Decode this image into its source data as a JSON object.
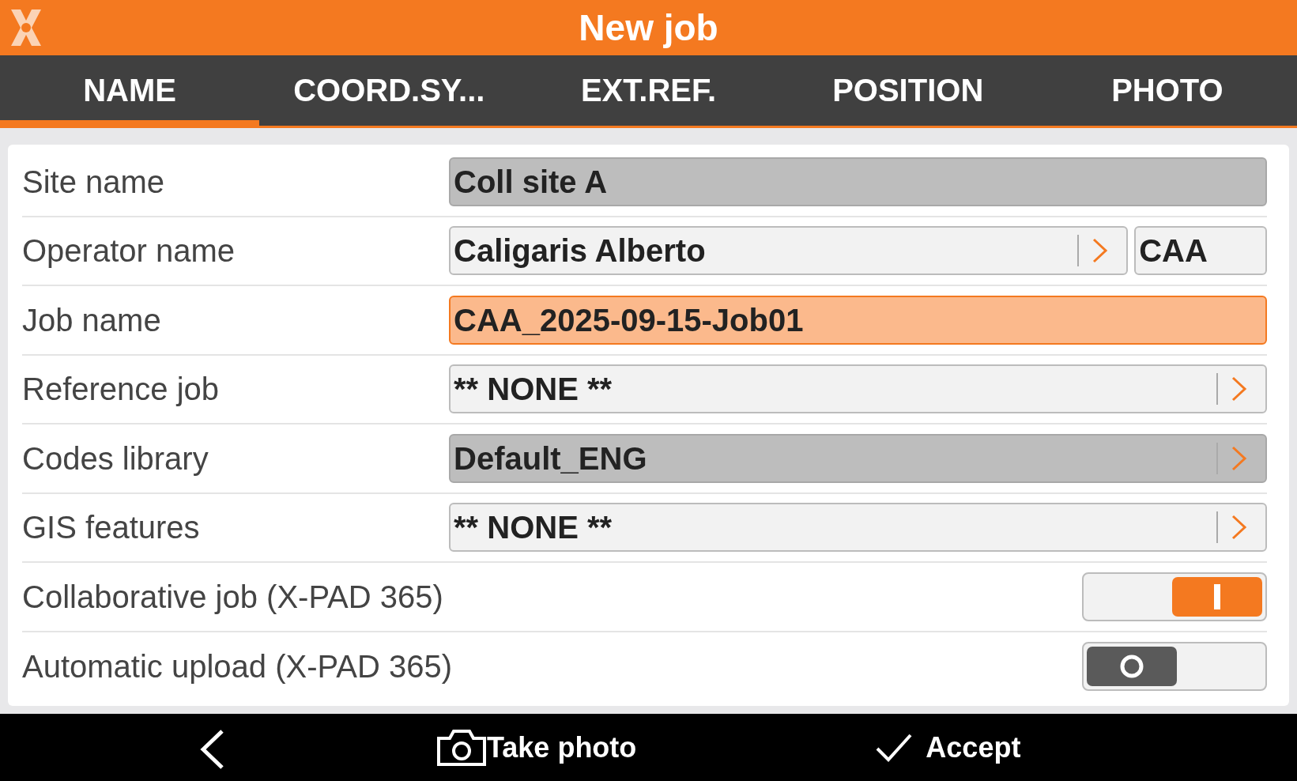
{
  "header": {
    "title": "New job"
  },
  "tabs": [
    {
      "label": "NAME",
      "selected": true
    },
    {
      "label": "COORD.SY...",
      "selected": false
    },
    {
      "label": "EXT.REF.",
      "selected": false
    },
    {
      "label": "POSITION",
      "selected": false
    },
    {
      "label": "PHOTO",
      "selected": false
    }
  ],
  "rows": [
    {
      "kind": "text",
      "label": "Site name",
      "value": "Coll site A",
      "disabled": true,
      "focused": false
    },
    {
      "kind": "operator",
      "label": "Operator name",
      "value": "Caligaris Alberto",
      "initials": "CAA"
    },
    {
      "kind": "text",
      "label": "Job name",
      "value": "CAA_2025-09-15-Job01",
      "disabled": false,
      "focused": true
    },
    {
      "kind": "picker",
      "label": "Reference job",
      "value": "** NONE **",
      "disabled": false
    },
    {
      "kind": "picker",
      "label": "Codes library",
      "value": "Default_ENG",
      "disabled": true
    },
    {
      "kind": "picker",
      "label": "GIS features",
      "value": "** NONE **",
      "disabled": false
    },
    {
      "kind": "toggle",
      "label": "Collaborative job (X-PAD 365)",
      "on": true
    },
    {
      "kind": "toggle",
      "label": "Automatic upload (X-PAD 365)",
      "on": false
    }
  ],
  "bottom_bar": {
    "take_photo": "Take photo",
    "accept": "Accept"
  }
}
